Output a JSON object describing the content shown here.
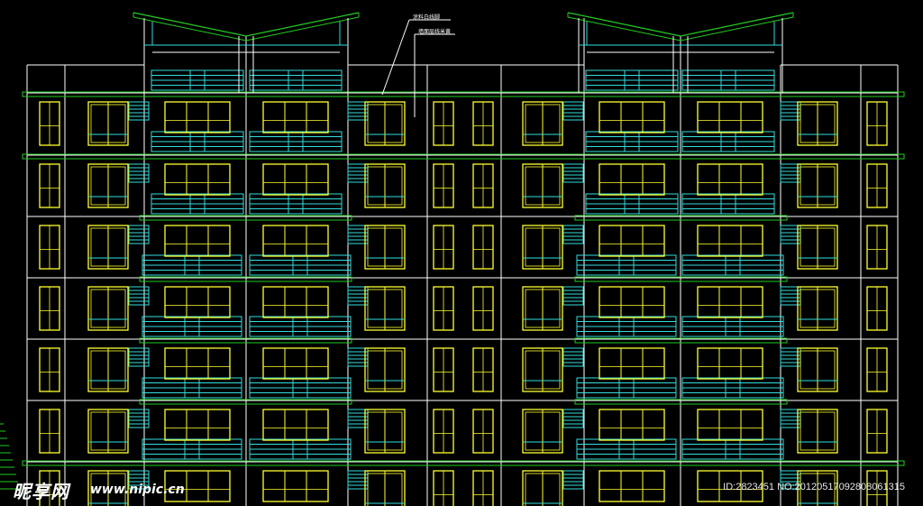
{
  "annotations": {
    "label_1": "涂料白线脚",
    "label_2": "墙面层线米黄"
  },
  "watermark": {
    "logo_text": "昵享网",
    "url_text": "www.nipic.cn",
    "id_text": "ID:2823451 NO:20120517092808061315"
  },
  "colors": {
    "background": "#000000",
    "frame": "#ffffff",
    "window": "#ffff33",
    "balcony": "#33dddd",
    "slab": "#22cc22",
    "roof": "#22cc22"
  }
}
